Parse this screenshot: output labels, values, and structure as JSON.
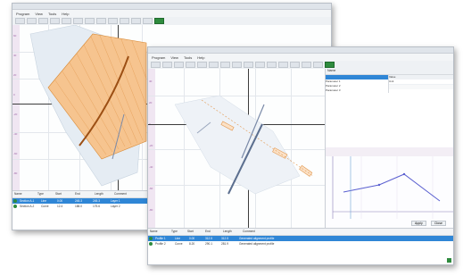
{
  "back_window": {
    "menu": [
      "Program",
      "View",
      "Tools",
      "Help"
    ],
    "ruler_values": [
      "60",
      "40",
      "20",
      "0",
      "-20",
      "-40",
      "-60",
      "-80"
    ],
    "table": {
      "headers": [
        "Name",
        "Type",
        "Start",
        "End",
        "Length",
        "Comment"
      ],
      "rows": [
        [
          "Section A-1",
          "Line",
          "0.00",
          "245.3",
          "245.3",
          "Layer 1"
        ],
        [
          "Section A-2",
          "Curve",
          "12.4",
          "188.0",
          "175.6",
          "Layer 2"
        ]
      ]
    }
  },
  "front_window": {
    "menu": [
      "Program",
      "View",
      "Tools",
      "Help"
    ],
    "ruler_values": [
      "40",
      "20",
      "0",
      "-20",
      "-40",
      "-60",
      "-80"
    ],
    "panel": {
      "fields": [
        "Name",
        "Value",
        "Unit"
      ],
      "rows": [
        "Parameter 1",
        "Parameter 2",
        "Parameter 3"
      ]
    },
    "profile_buttons": [
      "Apply",
      "Close"
    ],
    "table": {
      "headers": [
        "Name",
        "Type",
        "Start",
        "End",
        "Length",
        "Comment"
      ],
      "rows": [
        [
          "Profile 1",
          "Line",
          "0.00",
          "312.5",
          "312.5",
          "Generated alignment profile"
        ],
        [
          "Profile 2",
          "Curve",
          "8.20",
          "290.1",
          "281.9",
          "Generated alignment profile"
        ]
      ]
    }
  }
}
